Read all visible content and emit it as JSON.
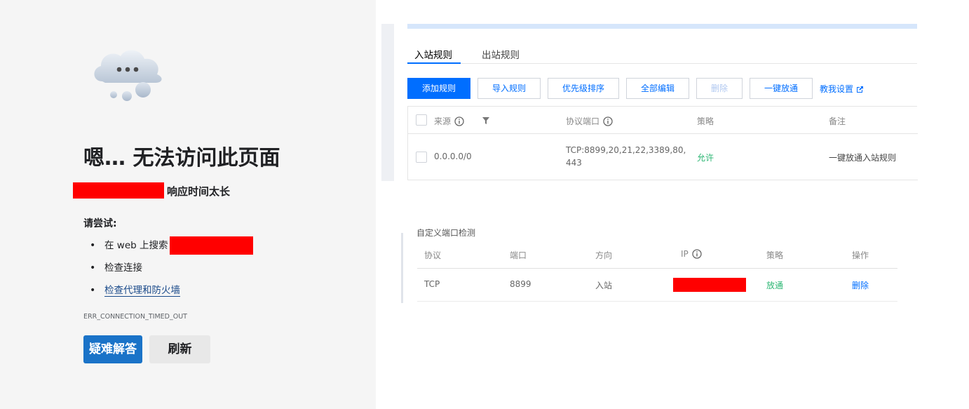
{
  "error_page": {
    "title": "嗯… 无法访问此页面",
    "description": "响应时间太长",
    "try_heading": "请尝试:",
    "suggestions": [
      {
        "bullet": "•",
        "text": "在 web 上搜索"
      },
      {
        "bullet": "•",
        "text": "检查连接"
      },
      {
        "bullet": "•",
        "text": "检查代理和防火墙"
      }
    ],
    "error_code": "ERR_CONNECTION_TIMED_OUT",
    "help_button": "疑难解答",
    "refresh_button": "刷新",
    "icon": "cloud-ellipsis-icon"
  },
  "firewall": {
    "tabs": [
      {
        "label": "入站规则",
        "active": true
      },
      {
        "label": "出站规则",
        "active": false
      }
    ],
    "toolbar": {
      "add": "添加规则",
      "import": "导入规则",
      "priority": "优先级排序",
      "edit_all": "全部编辑",
      "delete": "删除",
      "allow_all": "一键放通",
      "teach": "教我设置"
    },
    "columns": {
      "source": "来源",
      "port": "协议端口",
      "policy": "策略",
      "remark": "备注"
    },
    "rows": [
      {
        "source": "0.0.0.0/0",
        "port_line1": "TCP:8899,20,21,22,3389,80,",
        "port_line2": "443",
        "policy": "允许",
        "remark": "一键放通入站规则"
      }
    ],
    "colors": {
      "accent": "#006eff",
      "allow": "#2bb673"
    }
  },
  "port_check": {
    "title": "自定义端口检测",
    "columns": {
      "protocol": "协议",
      "port": "端口",
      "direction": "方向",
      "ip": "IP",
      "policy": "策略",
      "action": "操作"
    },
    "rows": [
      {
        "protocol": "TCP",
        "port": "8899",
        "direction": "入站",
        "policy": "放通",
        "action": "删除"
      }
    ]
  }
}
